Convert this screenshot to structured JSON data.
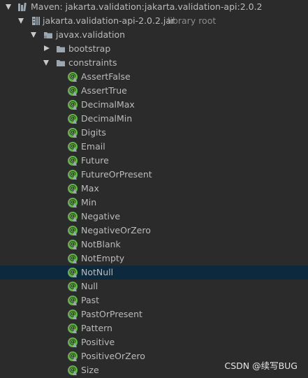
{
  "tree": {
    "library_label": "Maven: jakarta.validation:jakarta.validation-api:2.0.2",
    "jar_label": "jakarta.validation-api-2.0.2.jar",
    "jar_hint": "library root",
    "package_label": "javax.validation",
    "bootstrap_label": "bootstrap",
    "constraints_label": "constraints",
    "annotations": [
      "AssertFalse",
      "AssertTrue",
      "DecimalMax",
      "DecimalMin",
      "Digits",
      "Email",
      "Future",
      "FutureOrPresent",
      "Max",
      "Min",
      "Negative",
      "NegativeOrZero",
      "NotBlank",
      "NotEmpty",
      "NotNull",
      "Null",
      "Past",
      "PastOrPresent",
      "Pattern",
      "Positive",
      "PositiveOrZero",
      "Size"
    ],
    "selected_annotation": "NotNull"
  },
  "watermark": "CSDN @续写BUG",
  "colors": {
    "background": "#2b2b2b",
    "selection": "#0d293e",
    "annotation_icon": "#62b543",
    "text": "#bbbbbb",
    "hint_text": "#8c8c8c"
  },
  "icons": {
    "expanded": "triangle-down-icon",
    "collapsed": "triangle-right-icon",
    "library": "library-icon",
    "jar": "jar-icon",
    "package": "package-icon",
    "folder": "folder-icon",
    "annotation": "annotation-icon"
  }
}
